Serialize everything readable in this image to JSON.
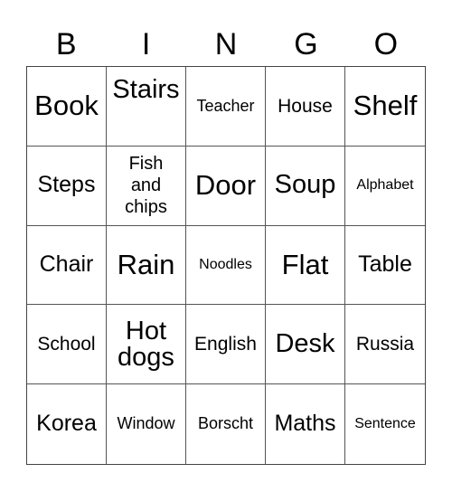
{
  "header": [
    "B",
    "I",
    "N",
    "G",
    "O"
  ],
  "cells": [
    "Book",
    "Stairs",
    "Teacher",
    "House",
    "Shelf",
    "Steps",
    "Fish and chips",
    "Door",
    "Soup",
    "Alphabet",
    "Chair",
    "Rain",
    "Noodles",
    "Flat",
    "Table",
    "School",
    "Hot dogs",
    "English",
    "Desk",
    "Russia",
    "Korea",
    "Window",
    "Borscht",
    "Maths",
    "Sentence"
  ]
}
